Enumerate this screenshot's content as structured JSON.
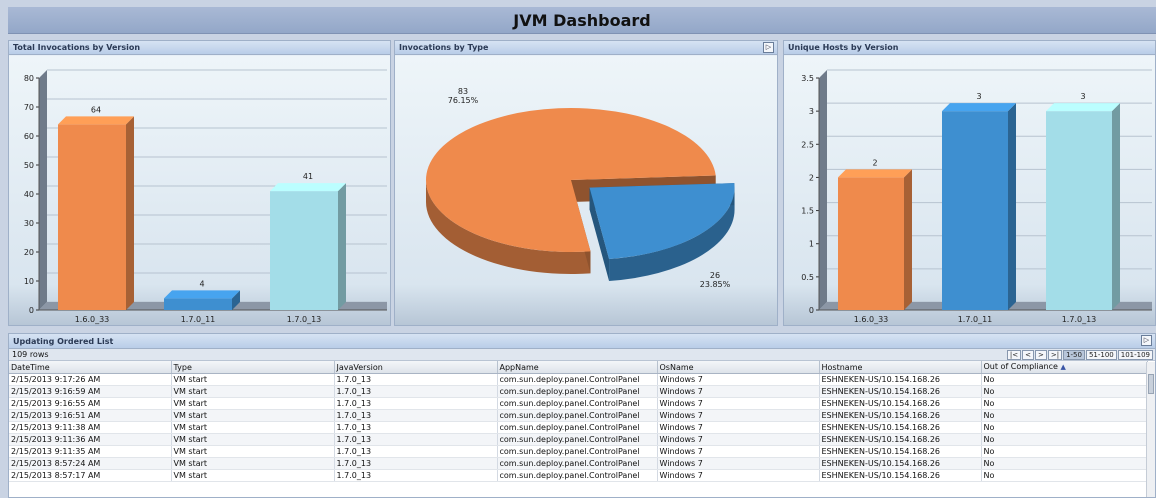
{
  "dashboard": {
    "title": "JVM Dashboard"
  },
  "panels": {
    "invocations_by_version": {
      "title": "Total Invocations by Version"
    },
    "invocations_by_type": {
      "title": "Invocations by Type",
      "expand": "▷"
    },
    "hosts_by_version": {
      "title": "Unique Hosts by Version"
    }
  },
  "colors": {
    "orange": "#ef8a4c",
    "blue": "#3e8fd0",
    "cyan": "#a3dde8"
  },
  "chart_data": [
    {
      "type": "bar",
      "title": "Total Invocations by Version",
      "categories": [
        "1.6.0_33",
        "1.7.0_11",
        "1.7.0_13"
      ],
      "values": [
        64,
        4,
        41
      ],
      "ylim": [
        0,
        80
      ],
      "yticks": [
        0,
        10,
        20,
        30,
        40,
        50,
        60,
        70,
        80
      ],
      "yticklabels": [
        "0",
        "10",
        "20",
        "30",
        "40",
        "50",
        "60",
        "70",
        "80"
      ],
      "grid": true
    },
    {
      "type": "pie",
      "title": "Invocations by Type",
      "slices": [
        {
          "value": 83,
          "label": "83",
          "pct": "76.15%",
          "color": "#ef8a4c"
        },
        {
          "value": 26,
          "label": "26",
          "pct": "23.85%",
          "color": "#3e8fd0"
        }
      ]
    },
    {
      "type": "bar",
      "title": "Unique Hosts by Version",
      "categories": [
        "1.6.0_33",
        "1.7.0_11",
        "1.7.0_13"
      ],
      "values": [
        2,
        3,
        3
      ],
      "ylim": [
        0,
        3.5
      ],
      "yticks": [
        0,
        0.5,
        1,
        1.5,
        2,
        2.5,
        3,
        3.5
      ],
      "yticklabels": [
        "0",
        "0.5",
        "1",
        "1.5",
        "2",
        "2.5",
        "3",
        "3.5"
      ],
      "grid": true
    }
  ],
  "list": {
    "title": "Updating Ordered List",
    "expand": "▷",
    "row_count": "109 rows",
    "pager": [
      "|<",
      "<",
      ">",
      ">|",
      "1-50",
      "51-100",
      "101-109"
    ],
    "columns": [
      "DateTime",
      "Type",
      "JavaVersion",
      "AppName",
      "OsName",
      "Hostname",
      "Out of Compliance"
    ],
    "sort_indicator": "▲",
    "rows": [
      [
        "2/15/2013 9:17:26 AM",
        "VM start",
        "1.7.0_13",
        "com.sun.deploy.panel.ControlPanel",
        "Windows 7",
        "ESHNEKEN-US/10.154.168.26",
        "No"
      ],
      [
        "2/15/2013 9:16:59 AM",
        "VM start",
        "1.7.0_13",
        "com.sun.deploy.panel.ControlPanel",
        "Windows 7",
        "ESHNEKEN-US/10.154.168.26",
        "No"
      ],
      [
        "2/15/2013 9:16:55 AM",
        "VM start",
        "1.7.0_13",
        "com.sun.deploy.panel.ControlPanel",
        "Windows 7",
        "ESHNEKEN-US/10.154.168.26",
        "No"
      ],
      [
        "2/15/2013 9:16:51 AM",
        "VM start",
        "1.7.0_13",
        "com.sun.deploy.panel.ControlPanel",
        "Windows 7",
        "ESHNEKEN-US/10.154.168.26",
        "No"
      ],
      [
        "2/15/2013 9:11:38 AM",
        "VM start",
        "1.7.0_13",
        "com.sun.deploy.panel.ControlPanel",
        "Windows 7",
        "ESHNEKEN-US/10.154.168.26",
        "No"
      ],
      [
        "2/15/2013 9:11:36 AM",
        "VM start",
        "1.7.0_13",
        "com.sun.deploy.panel.ControlPanel",
        "Windows 7",
        "ESHNEKEN-US/10.154.168.26",
        "No"
      ],
      [
        "2/15/2013 9:11:35 AM",
        "VM start",
        "1.7.0_13",
        "com.sun.deploy.panel.ControlPanel",
        "Windows 7",
        "ESHNEKEN-US/10.154.168.26",
        "No"
      ],
      [
        "2/15/2013 8:57:24 AM",
        "VM start",
        "1.7.0_13",
        "com.sun.deploy.panel.ControlPanel",
        "Windows 7",
        "ESHNEKEN-US/10.154.168.26",
        "No"
      ],
      [
        "2/15/2013 8:57:17 AM",
        "VM start",
        "1.7.0_13",
        "com.sun.deploy.panel.ControlPanel",
        "Windows 7",
        "ESHNEKEN-US/10.154.168.26",
        "No"
      ]
    ]
  }
}
